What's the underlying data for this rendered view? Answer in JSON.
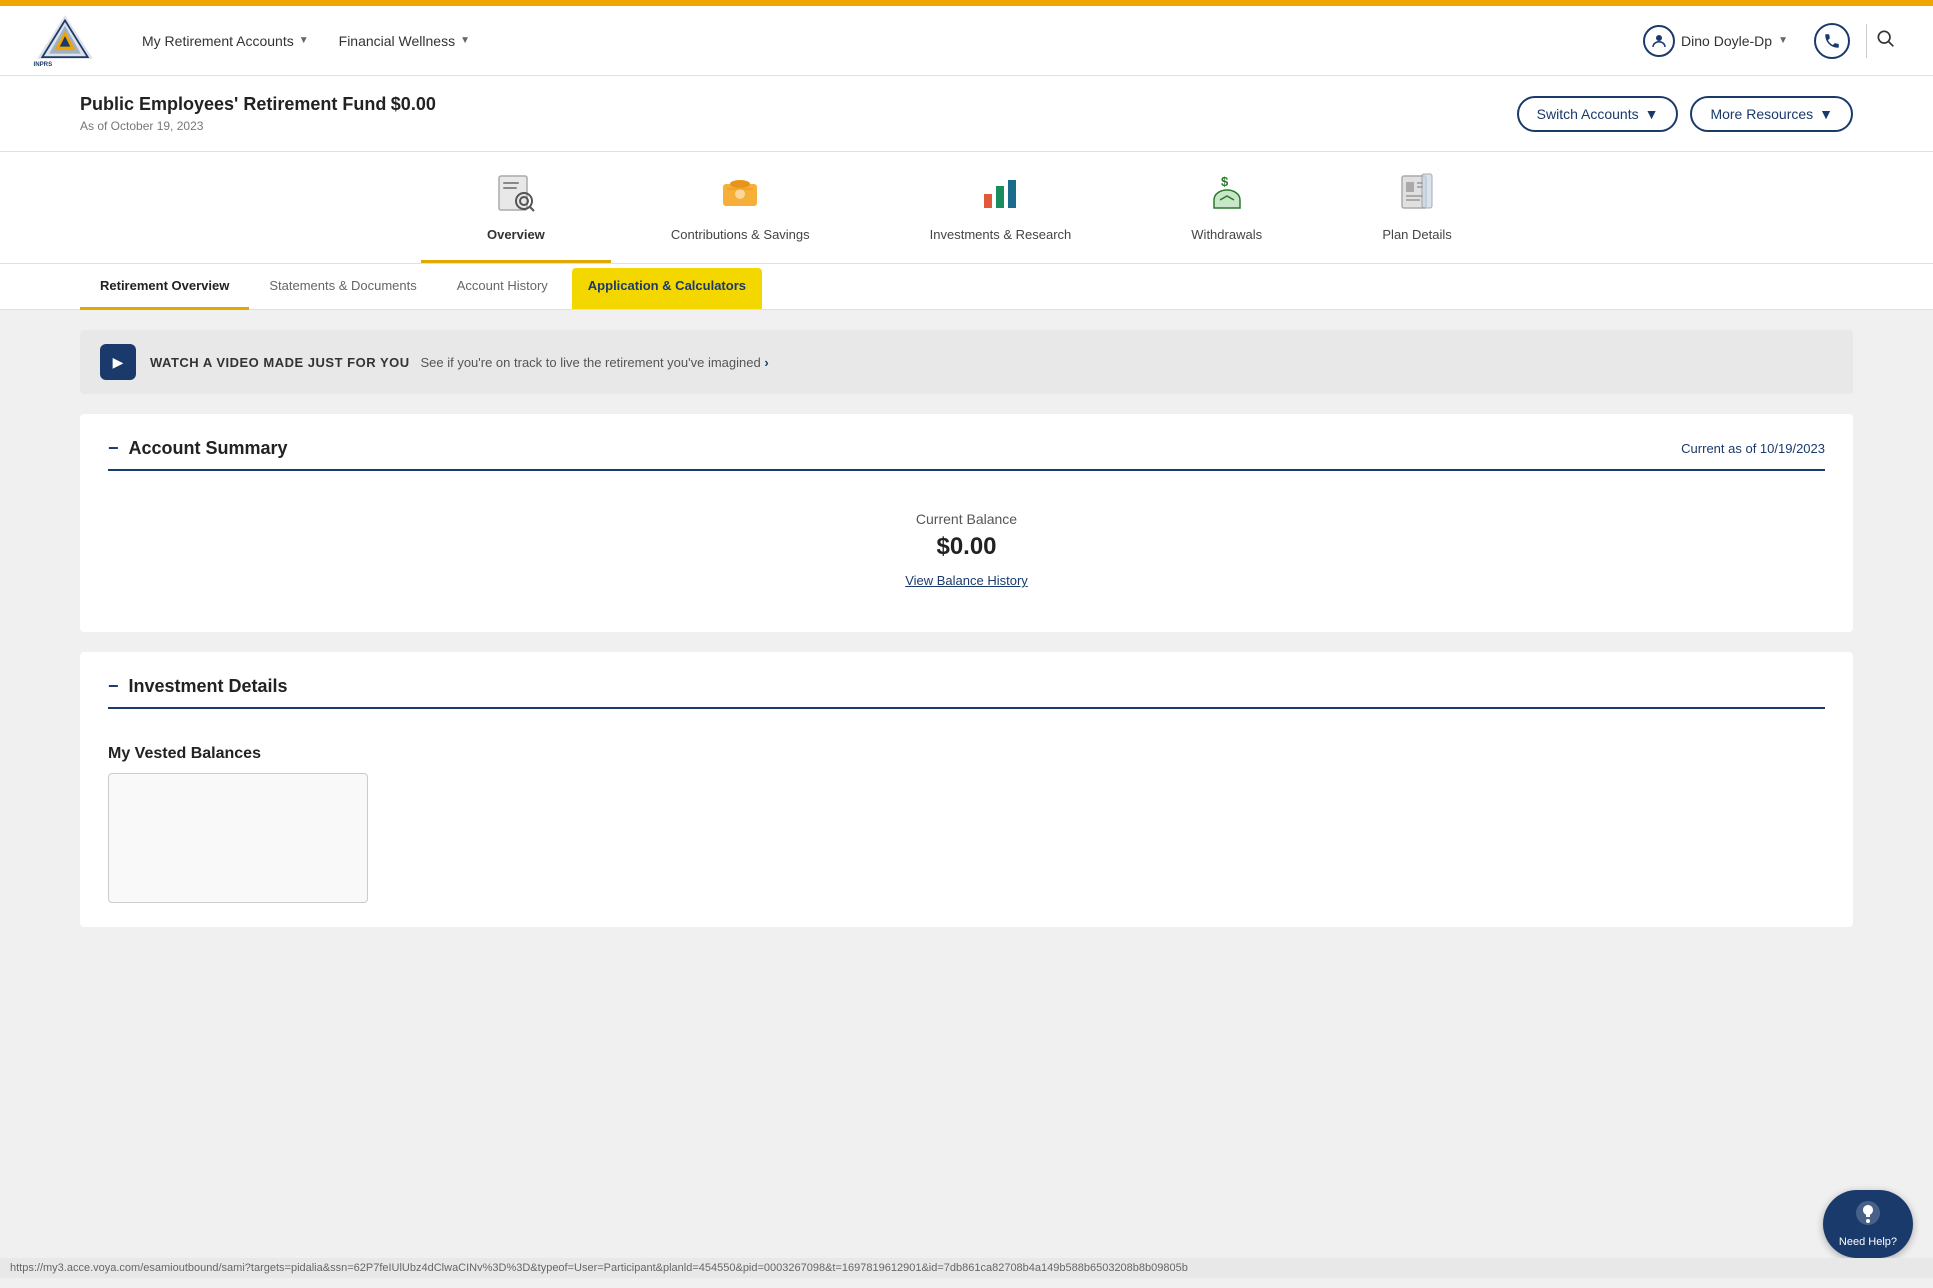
{
  "gold_bar": {},
  "header": {
    "logo_alt": "INPRS - Indiana Public Retirement System",
    "nav": [
      {
        "label": "My Retirement Accounts",
        "has_arrow": true
      },
      {
        "label": "Financial Wellness",
        "has_arrow": true
      }
    ],
    "user": {
      "name": "Dino Doyle-Dp",
      "has_arrow": true
    },
    "search_label": "search"
  },
  "account_bar": {
    "fund_name": "Public Employees' Retirement Fund",
    "balance": "$0.00",
    "as_of": "As of October 19, 2023",
    "switch_accounts_label": "Switch Accounts",
    "more_resources_label": "More Resources"
  },
  "icon_tabs": [
    {
      "label": "Overview",
      "icon": "📋",
      "active": true
    },
    {
      "label": "Contributions & Savings",
      "icon": "💳",
      "active": false
    },
    {
      "label": "Investments & Research",
      "icon": "📊",
      "active": false
    },
    {
      "label": "Withdrawals",
      "icon": "💵",
      "active": false
    },
    {
      "label": "Plan Details",
      "icon": "📄",
      "active": false
    }
  ],
  "sub_tabs": [
    {
      "label": "Retirement Overview",
      "active": true,
      "highlight": false
    },
    {
      "label": "Statements & Documents",
      "active": false,
      "highlight": false
    },
    {
      "label": "Account History",
      "active": false,
      "highlight": false
    },
    {
      "label": "Application & Calculators",
      "active": false,
      "highlight": true
    }
  ],
  "video_banner": {
    "play_label": "▶",
    "title": "WATCH A VIDEO MADE JUST FOR YOU",
    "subtitle": "See if you're on track to live the retirement you've imagined",
    "chevron": "›"
  },
  "account_summary": {
    "title": "Account Summary",
    "collapse_label": "−",
    "current_as_of": "Current as of 10/19/2023",
    "current_balance_label": "Current Balance",
    "current_balance": "$0.00",
    "view_balance_history_label": "View Balance History"
  },
  "investment_details": {
    "title": "Investment Details",
    "collapse_label": "−",
    "vested_balances_title": "My Vested Balances"
  },
  "need_help": {
    "label": "Need Help?",
    "icon": "💬"
  },
  "url_bar": {
    "text": "https://my3.acce.voya.com/esamioutbound/sami?targets=pidalia&ssn=62P7feIUlUbz4dClwaCINv%3D%3D&typeof=User=Participant&planld=454550&pid=0003267098&t=1697819612901&id=7db861ca82708b4a149b588b6503208b8b09805b"
  }
}
